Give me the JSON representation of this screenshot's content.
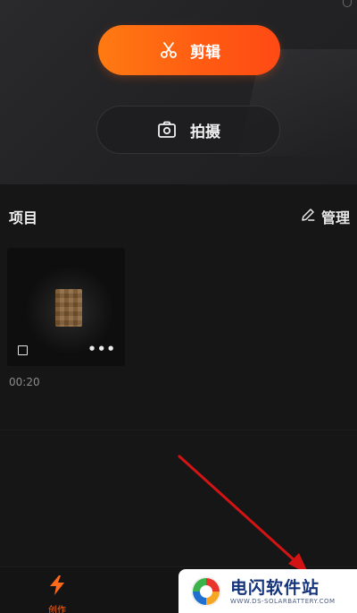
{
  "hero": {
    "edit_button": {
      "label": "剪辑",
      "icon": "scissors-icon"
    },
    "shoot_button": {
      "label": "拍摄",
      "icon": "camera-icon"
    }
  },
  "projects": {
    "title": "项目",
    "manage_label": "管理",
    "items": [
      {
        "duration": "00:20",
        "more_label": "•••"
      }
    ]
  },
  "tabbar": {
    "create_label": "创作"
  },
  "watermark": {
    "title": "电闪软件站",
    "url": "WWW.DS-SOLARBATTERY.COM"
  },
  "colors": {
    "accent": "#ff6a1a",
    "background": "#161616",
    "annotation_arrow": "#d41414",
    "watermark_blue": "#14337a"
  }
}
